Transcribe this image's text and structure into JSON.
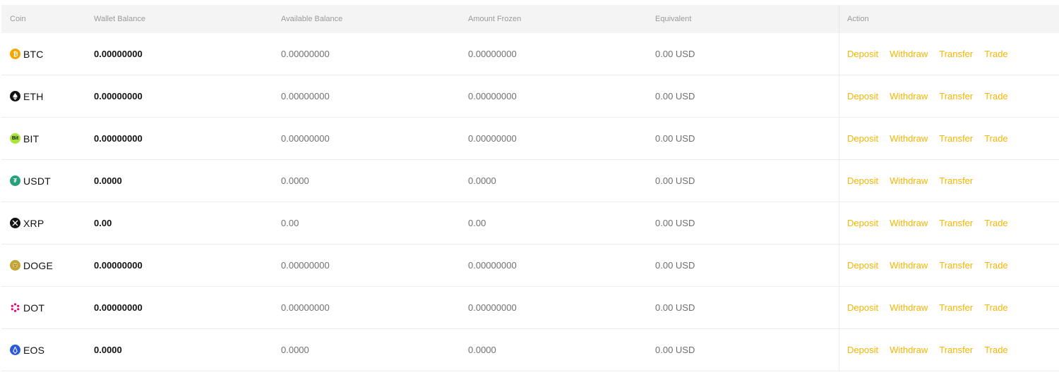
{
  "header": {
    "coin": "Coin",
    "wallet_balance": "Wallet Balance",
    "available_balance": "Available Balance",
    "amount_frozen": "Amount Frozen",
    "equivalent": "Equivalent",
    "action": "Action"
  },
  "colors": {
    "accent": "#f7b500",
    "btc": "#f7a600",
    "eth": "#121214",
    "bit": "#a8e63a",
    "usdt": "#26a17b",
    "xrp": "#121214",
    "doge": "#c2a633",
    "dot": "#e6007a",
    "eos": "#2a5ada"
  },
  "rows": [
    {
      "coin": "BTC",
      "icon": "bitcoin-icon",
      "wallet": "0.00000000",
      "available": "0.00000000",
      "frozen": "0.00000000",
      "equivalent": "0.00 USD",
      "actions": [
        "Deposit",
        "Withdraw",
        "Transfer",
        "Trade"
      ]
    },
    {
      "coin": "ETH",
      "icon": "ethereum-icon",
      "wallet": "0.00000000",
      "available": "0.00000000",
      "frozen": "0.00000000",
      "equivalent": "0.00 USD",
      "actions": [
        "Deposit",
        "Withdraw",
        "Transfer",
        "Trade"
      ]
    },
    {
      "coin": "BIT",
      "icon": "bit-icon",
      "icon_text": "Bit",
      "wallet": "0.00000000",
      "available": "0.00000000",
      "frozen": "0.00000000",
      "equivalent": "0.00 USD",
      "actions": [
        "Deposit",
        "Withdraw",
        "Transfer",
        "Trade"
      ]
    },
    {
      "coin": "USDT",
      "icon": "tether-icon",
      "icon_text": "₮",
      "wallet": "0.0000",
      "available": "0.0000",
      "frozen": "0.0000",
      "equivalent": "0.00 USD",
      "actions": [
        "Deposit",
        "Withdraw",
        "Transfer"
      ]
    },
    {
      "coin": "XRP",
      "icon": "xrp-icon",
      "wallet": "0.00",
      "available": "0.00",
      "frozen": "0.00",
      "equivalent": "0.00 USD",
      "actions": [
        "Deposit",
        "Withdraw",
        "Transfer",
        "Trade"
      ]
    },
    {
      "coin": "DOGE",
      "icon": "dogecoin-icon",
      "wallet": "0.00000000",
      "available": "0.00000000",
      "frozen": "0.00000000",
      "equivalent": "0.00 USD",
      "actions": [
        "Deposit",
        "Withdraw",
        "Transfer",
        "Trade"
      ]
    },
    {
      "coin": "DOT",
      "icon": "polkadot-icon",
      "wallet": "0.00000000",
      "available": "0.00000000",
      "frozen": "0.00000000",
      "equivalent": "0.00 USD",
      "actions": [
        "Deposit",
        "Withdraw",
        "Transfer",
        "Trade"
      ]
    },
    {
      "coin": "EOS",
      "icon": "eos-icon",
      "wallet": "0.0000",
      "available": "0.0000",
      "frozen": "0.0000",
      "equivalent": "0.00 USD",
      "actions": [
        "Deposit",
        "Withdraw",
        "Transfer",
        "Trade"
      ]
    }
  ]
}
